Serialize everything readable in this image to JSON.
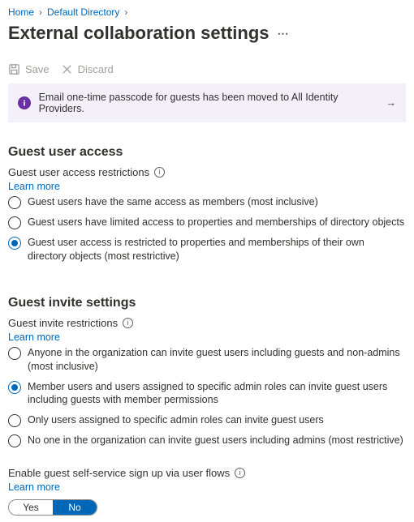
{
  "breadcrumb": {
    "home": "Home",
    "dir": "Default Directory"
  },
  "title": "External collaboration settings",
  "toolbar": {
    "save": "Save",
    "discard": "Discard"
  },
  "banner": {
    "text": "Email one-time passcode for guests has been moved to All Identity Providers."
  },
  "learn_more": "Learn more",
  "access": {
    "heading": "Guest user access",
    "sub": "Guest user access restrictions",
    "opt1": "Guest users have the same access as members (most inclusive)",
    "opt2": "Guest users have limited access to properties and memberships of directory objects",
    "opt3": "Guest user access is restricted to properties and memberships of their own directory objects (most restrictive)"
  },
  "invite": {
    "heading": "Guest invite settings",
    "sub": "Guest invite restrictions",
    "opt1": "Anyone in the organization can invite guest users including guests and non-admins (most inclusive)",
    "opt2": "Member users and users assigned to specific admin roles can invite guest users including guests with member permissions",
    "opt3": "Only users assigned to specific admin roles can invite guest users",
    "opt4": "No one in the organization can invite guest users including admins (most restrictive)"
  },
  "self_service": {
    "label": "Enable guest self-service sign up via user flows",
    "yes": "Yes",
    "no": "No"
  }
}
